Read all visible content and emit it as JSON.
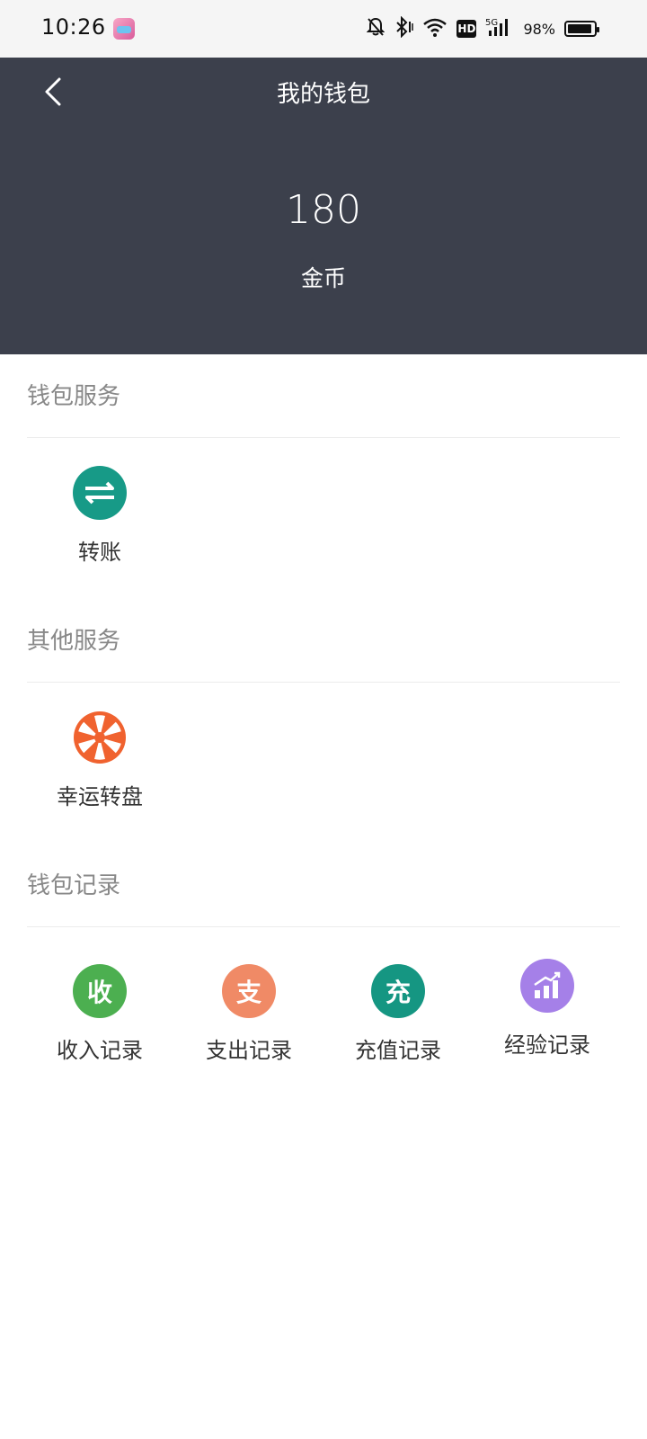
{
  "status_bar": {
    "time": "10:26",
    "hd": "HD",
    "network": "5G",
    "battery": "98%"
  },
  "header": {
    "title": "我的钱包",
    "balance": "180",
    "unit": "金币"
  },
  "sections": {
    "wallet_services": {
      "title": "钱包服务",
      "items": [
        {
          "label": "转账",
          "icon": "transfer-arrows-icon",
          "color": "#179a87"
        }
      ]
    },
    "other_services": {
      "title": "其他服务",
      "items": [
        {
          "label": "幸运转盘",
          "icon": "lucky-wheel-icon",
          "color": "#f0622f"
        }
      ]
    },
    "wallet_records": {
      "title": "钱包记录",
      "items": [
        {
          "label": "收入记录",
          "glyph": "收",
          "icon": "income-icon",
          "color": "#4caf50"
        },
        {
          "label": "支出记录",
          "glyph": "支",
          "icon": "expense-icon",
          "color": "#f08a66"
        },
        {
          "label": "充值记录",
          "glyph": "充",
          "icon": "recharge-icon",
          "color": "#159682"
        },
        {
          "label": "经验记录",
          "icon": "experience-chart-icon",
          "color": "#a580e8"
        }
      ]
    }
  }
}
